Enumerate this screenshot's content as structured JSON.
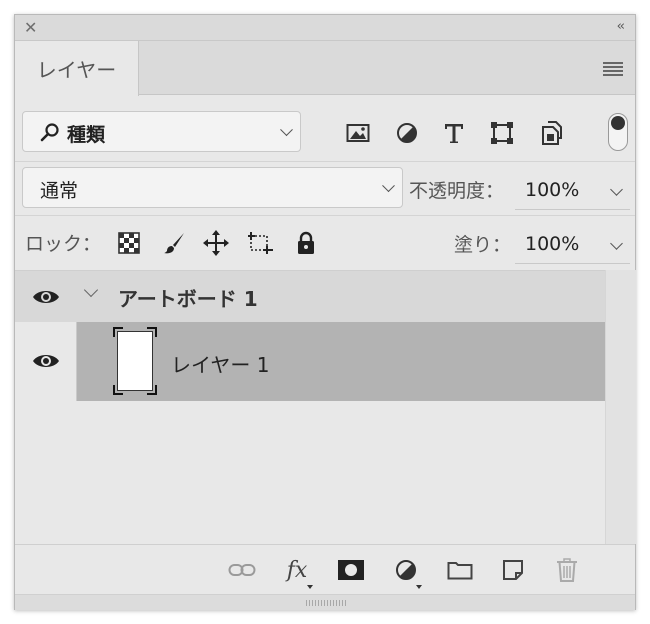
{
  "window": {
    "collapse_glyph": "‹‹"
  },
  "tabs": [
    {
      "label": "レイヤー",
      "active": true
    }
  ],
  "filter": {
    "selected": "種類",
    "icons": [
      "image-filter-icon",
      "adjustment-filter-icon",
      "type-filter-icon",
      "shape-filter-icon",
      "smart-object-filter-icon"
    ],
    "toggle_on": true
  },
  "blend": {
    "mode": "通常",
    "opacity_label": "不透明度：",
    "opacity_value": "100%"
  },
  "lock": {
    "label": "ロック：",
    "icons": [
      "lock-transparency-icon",
      "lock-pixels-icon",
      "lock-position-icon",
      "lock-artboard-icon",
      "lock-all-icon"
    ],
    "fill_label": "塗り：",
    "fill_value": "100%"
  },
  "layers": {
    "artboard": {
      "name": "アートボード 1",
      "visible": true,
      "expanded": true
    },
    "items": [
      {
        "name": "レイヤー 1",
        "visible": true,
        "selected": true
      }
    ]
  },
  "bottom_tools": [
    "link-layers-icon",
    "fx-icon",
    "layer-mask-icon",
    "adjustment-layer-icon",
    "new-group-icon",
    "new-layer-icon",
    "trash-icon"
  ],
  "bottom_labels": {
    "fx": "fx"
  },
  "colors": {
    "panel_bg": "#e8e8e8",
    "selected_row": "#b3b3b3",
    "artboard_row": "#d8d8d8"
  }
}
